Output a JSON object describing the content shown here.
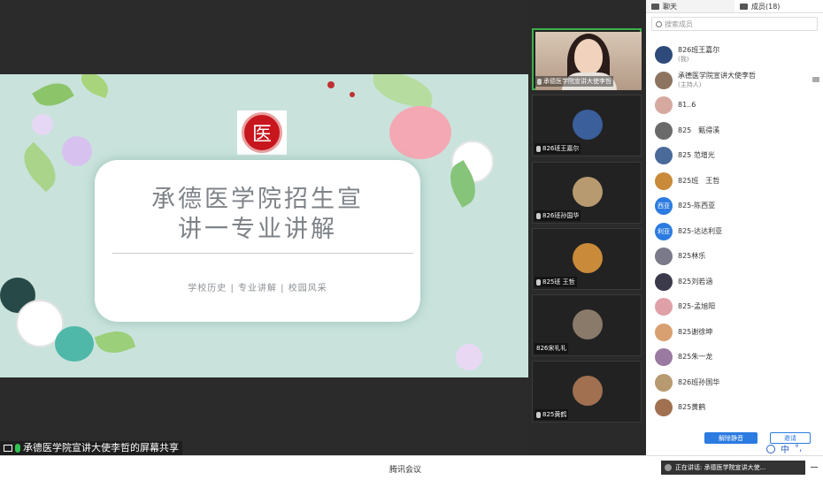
{
  "slide": {
    "title": "承德医学院招生宣讲一专业讲解",
    "subtitle": "学校历史 | 专业讲解 | 校园风采",
    "logo_glyph": "医"
  },
  "share_label": "承德医学院宣讲大使李哲的屏幕共享",
  "video_tiles": [
    {
      "name": "承德医学院宣讲大使李哲",
      "avatar_color": "#c0b09e"
    },
    {
      "name": "826班王嘉尔",
      "avatar_color": "#3a5f9a"
    },
    {
      "name": "826班孙国华",
      "avatar_color": "#b89a70"
    },
    {
      "name": "825班 王哲",
      "avatar_color": "#c98a3a"
    },
    {
      "name": "826宋礼礼",
      "avatar_color": "#8a7a6a"
    },
    {
      "name": "825黄鹤",
      "avatar_color": "#a07050"
    }
  ],
  "panel": {
    "tab_chat": "聊天",
    "tab_members": "成员(18)",
    "search_placeholder": "搜索成员",
    "members": [
      {
        "name": "826班王嘉尔",
        "sub": "(我)",
        "color": "#2e4a7a",
        "initials": ""
      },
      {
        "name": "承德医学院宣讲大使李哲",
        "sub": "(主持人)",
        "color": "#8c7460",
        "initials": ""
      },
      {
        "name": "81..6",
        "sub": "",
        "color": "#d6a9a0",
        "initials": ""
      },
      {
        "name": "825　甄得溪",
        "sub": "",
        "color": "#6a6a6a",
        "initials": ""
      },
      {
        "name": "825 范增光",
        "sub": "",
        "color": "#4a6a9a",
        "initials": ""
      },
      {
        "name": "825班　王哲",
        "sub": "",
        "color": "#c98a3a",
        "initials": ""
      },
      {
        "name": "825-陈西亚",
        "sub": "",
        "color": "#2b7be0",
        "initials": "西亚"
      },
      {
        "name": "825-达达利亚",
        "sub": "",
        "color": "#2b7be0",
        "initials": "利亚"
      },
      {
        "name": "825林乐",
        "sub": "",
        "color": "#7a7a8a",
        "initials": ""
      },
      {
        "name": "825刘若涵",
        "sub": "",
        "color": "#3a3a4a",
        "initials": ""
      },
      {
        "name": "825-孟旭阳",
        "sub": "",
        "color": "#e0a0a8",
        "initials": ""
      },
      {
        "name": "825谢徐坤",
        "sub": "",
        "color": "#d8a070",
        "initials": ""
      },
      {
        "name": "825朱一龙",
        "sub": "",
        "color": "#9a7aa0",
        "initials": ""
      },
      {
        "name": "826班孙国华",
        "sub": "",
        "color": "#b89a70",
        "initials": ""
      },
      {
        "name": "825黄鹤",
        "sub": "",
        "color": "#a07050",
        "initials": ""
      }
    ],
    "unmute_label": "解除静音",
    "invite_label": "邀请"
  },
  "bottom": {
    "app_title": "腾讯会议",
    "speaking": "正在讲话: 承德医学院宣讲大使..."
  },
  "ime": {
    "lang": "中",
    "ch": "°,"
  }
}
